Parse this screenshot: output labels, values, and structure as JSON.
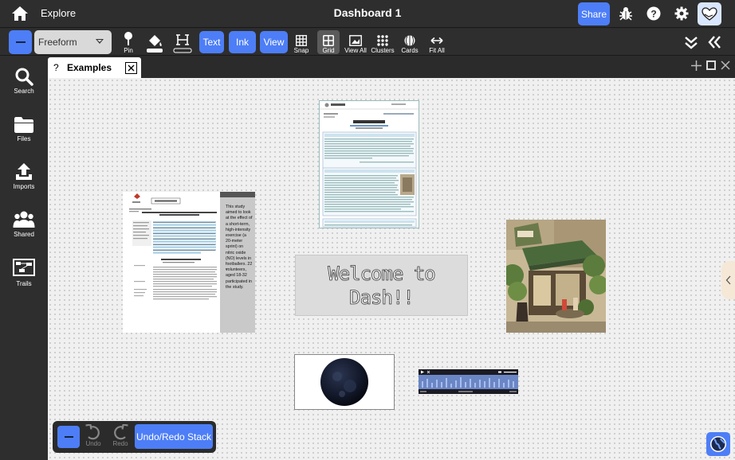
{
  "topbar": {
    "explore_label": "Explore",
    "title": "Dashboard 1",
    "share_label": "Share"
  },
  "toolbar": {
    "mode": "Freeform",
    "tools": {
      "pin": "Pin",
      "text": "Text",
      "ink": "Ink",
      "view": "View",
      "snap": "Snap",
      "grid": "Grid",
      "view_all": "View All",
      "clusters": "Clusters",
      "cards": "Cards",
      "fit_all": "Fit All"
    }
  },
  "sidebar": {
    "items": [
      {
        "label": "Search",
        "icon": "search-icon"
      },
      {
        "label": "Files",
        "icon": "folder-icon"
      },
      {
        "label": "Imports",
        "icon": "upload-icon"
      },
      {
        "label": "Shared",
        "icon": "people-icon"
      },
      {
        "label": "Trails",
        "icon": "trails-icon"
      }
    ]
  },
  "tab": {
    "help_glyph": "?",
    "label": "Examples"
  },
  "canvas": {
    "welcome_text": "Welcome to Dash!!",
    "research_sidebar_text": "This study aimed to look at the effect of a short-term, high-intensity exercise (a 20-meter sprint) on nitric oxide (NO) levels in footballers. 22 volunteers, aged 18-32 participated in the study."
  },
  "undo_panel": {
    "undo_label": "Undo",
    "redo_label": "Redo",
    "stack_label": "Undo/Redo Stack"
  },
  "colors": {
    "accent": "#4d7ef7",
    "chrome": "#2e2e2e",
    "canvas": "#f0f0f0"
  }
}
